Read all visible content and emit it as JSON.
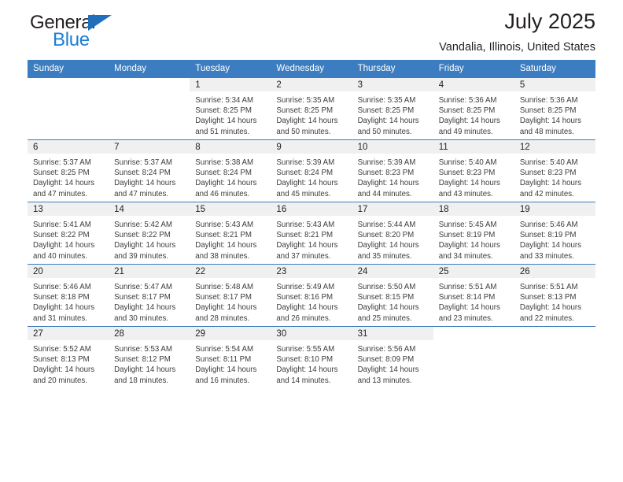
{
  "brand": {
    "name_top": "General",
    "name_bottom": "Blue",
    "triangle_icon": "triangle-icon",
    "color_dark": "#231f20",
    "color_blue": "#1b7fd4"
  },
  "header": {
    "title": "July 2025",
    "subtitle": "Vandalia, Illinois, United States",
    "accent_color": "#3b7dc0"
  },
  "calendar": {
    "weekday_headers": [
      "Sunday",
      "Monday",
      "Tuesday",
      "Wednesday",
      "Thursday",
      "Friday",
      "Saturday"
    ],
    "weeks": [
      [
        {
          "day": "",
          "blank": true,
          "sunrise": "",
          "sunset": "",
          "daylight_line1": "",
          "daylight_line2": ""
        },
        {
          "day": "",
          "blank": true,
          "sunrise": "",
          "sunset": "",
          "daylight_line1": "",
          "daylight_line2": ""
        },
        {
          "day": "1",
          "sunrise": "Sunrise: 5:34 AM",
          "sunset": "Sunset: 8:25 PM",
          "daylight_line1": "Daylight: 14 hours",
          "daylight_line2": "and 51 minutes."
        },
        {
          "day": "2",
          "sunrise": "Sunrise: 5:35 AM",
          "sunset": "Sunset: 8:25 PM",
          "daylight_line1": "Daylight: 14 hours",
          "daylight_line2": "and 50 minutes."
        },
        {
          "day": "3",
          "sunrise": "Sunrise: 5:35 AM",
          "sunset": "Sunset: 8:25 PM",
          "daylight_line1": "Daylight: 14 hours",
          "daylight_line2": "and 50 minutes."
        },
        {
          "day": "4",
          "sunrise": "Sunrise: 5:36 AM",
          "sunset": "Sunset: 8:25 PM",
          "daylight_line1": "Daylight: 14 hours",
          "daylight_line2": "and 49 minutes."
        },
        {
          "day": "5",
          "sunrise": "Sunrise: 5:36 AM",
          "sunset": "Sunset: 8:25 PM",
          "daylight_line1": "Daylight: 14 hours",
          "daylight_line2": "and 48 minutes."
        }
      ],
      [
        {
          "day": "6",
          "sunrise": "Sunrise: 5:37 AM",
          "sunset": "Sunset: 8:25 PM",
          "daylight_line1": "Daylight: 14 hours",
          "daylight_line2": "and 47 minutes."
        },
        {
          "day": "7",
          "sunrise": "Sunrise: 5:37 AM",
          "sunset": "Sunset: 8:24 PM",
          "daylight_line1": "Daylight: 14 hours",
          "daylight_line2": "and 47 minutes."
        },
        {
          "day": "8",
          "sunrise": "Sunrise: 5:38 AM",
          "sunset": "Sunset: 8:24 PM",
          "daylight_line1": "Daylight: 14 hours",
          "daylight_line2": "and 46 minutes."
        },
        {
          "day": "9",
          "sunrise": "Sunrise: 5:39 AM",
          "sunset": "Sunset: 8:24 PM",
          "daylight_line1": "Daylight: 14 hours",
          "daylight_line2": "and 45 minutes."
        },
        {
          "day": "10",
          "sunrise": "Sunrise: 5:39 AM",
          "sunset": "Sunset: 8:23 PM",
          "daylight_line1": "Daylight: 14 hours",
          "daylight_line2": "and 44 minutes."
        },
        {
          "day": "11",
          "sunrise": "Sunrise: 5:40 AM",
          "sunset": "Sunset: 8:23 PM",
          "daylight_line1": "Daylight: 14 hours",
          "daylight_line2": "and 43 minutes."
        },
        {
          "day": "12",
          "sunrise": "Sunrise: 5:40 AM",
          "sunset": "Sunset: 8:23 PM",
          "daylight_line1": "Daylight: 14 hours",
          "daylight_line2": "and 42 minutes."
        }
      ],
      [
        {
          "day": "13",
          "sunrise": "Sunrise: 5:41 AM",
          "sunset": "Sunset: 8:22 PM",
          "daylight_line1": "Daylight: 14 hours",
          "daylight_line2": "and 40 minutes."
        },
        {
          "day": "14",
          "sunrise": "Sunrise: 5:42 AM",
          "sunset": "Sunset: 8:22 PM",
          "daylight_line1": "Daylight: 14 hours",
          "daylight_line2": "and 39 minutes."
        },
        {
          "day": "15",
          "sunrise": "Sunrise: 5:43 AM",
          "sunset": "Sunset: 8:21 PM",
          "daylight_line1": "Daylight: 14 hours",
          "daylight_line2": "and 38 minutes."
        },
        {
          "day": "16",
          "sunrise": "Sunrise: 5:43 AM",
          "sunset": "Sunset: 8:21 PM",
          "daylight_line1": "Daylight: 14 hours",
          "daylight_line2": "and 37 minutes."
        },
        {
          "day": "17",
          "sunrise": "Sunrise: 5:44 AM",
          "sunset": "Sunset: 8:20 PM",
          "daylight_line1": "Daylight: 14 hours",
          "daylight_line2": "and 35 minutes."
        },
        {
          "day": "18",
          "sunrise": "Sunrise: 5:45 AM",
          "sunset": "Sunset: 8:19 PM",
          "daylight_line1": "Daylight: 14 hours",
          "daylight_line2": "and 34 minutes."
        },
        {
          "day": "19",
          "sunrise": "Sunrise: 5:46 AM",
          "sunset": "Sunset: 8:19 PM",
          "daylight_line1": "Daylight: 14 hours",
          "daylight_line2": "and 33 minutes."
        }
      ],
      [
        {
          "day": "20",
          "sunrise": "Sunrise: 5:46 AM",
          "sunset": "Sunset: 8:18 PM",
          "daylight_line1": "Daylight: 14 hours",
          "daylight_line2": "and 31 minutes."
        },
        {
          "day": "21",
          "sunrise": "Sunrise: 5:47 AM",
          "sunset": "Sunset: 8:17 PM",
          "daylight_line1": "Daylight: 14 hours",
          "daylight_line2": "and 30 minutes."
        },
        {
          "day": "22",
          "sunrise": "Sunrise: 5:48 AM",
          "sunset": "Sunset: 8:17 PM",
          "daylight_line1": "Daylight: 14 hours",
          "daylight_line2": "and 28 minutes."
        },
        {
          "day": "23",
          "sunrise": "Sunrise: 5:49 AM",
          "sunset": "Sunset: 8:16 PM",
          "daylight_line1": "Daylight: 14 hours",
          "daylight_line2": "and 26 minutes."
        },
        {
          "day": "24",
          "sunrise": "Sunrise: 5:50 AM",
          "sunset": "Sunset: 8:15 PM",
          "daylight_line1": "Daylight: 14 hours",
          "daylight_line2": "and 25 minutes."
        },
        {
          "day": "25",
          "sunrise": "Sunrise: 5:51 AM",
          "sunset": "Sunset: 8:14 PM",
          "daylight_line1": "Daylight: 14 hours",
          "daylight_line2": "and 23 minutes."
        },
        {
          "day": "26",
          "sunrise": "Sunrise: 5:51 AM",
          "sunset": "Sunset: 8:13 PM",
          "daylight_line1": "Daylight: 14 hours",
          "daylight_line2": "and 22 minutes."
        }
      ],
      [
        {
          "day": "27",
          "sunrise": "Sunrise: 5:52 AM",
          "sunset": "Sunset: 8:13 PM",
          "daylight_line1": "Daylight: 14 hours",
          "daylight_line2": "and 20 minutes."
        },
        {
          "day": "28",
          "sunrise": "Sunrise: 5:53 AM",
          "sunset": "Sunset: 8:12 PM",
          "daylight_line1": "Daylight: 14 hours",
          "daylight_line2": "and 18 minutes."
        },
        {
          "day": "29",
          "sunrise": "Sunrise: 5:54 AM",
          "sunset": "Sunset: 8:11 PM",
          "daylight_line1": "Daylight: 14 hours",
          "daylight_line2": "and 16 minutes."
        },
        {
          "day": "30",
          "sunrise": "Sunrise: 5:55 AM",
          "sunset": "Sunset: 8:10 PM",
          "daylight_line1": "Daylight: 14 hours",
          "daylight_line2": "and 14 minutes."
        },
        {
          "day": "31",
          "sunrise": "Sunrise: 5:56 AM",
          "sunset": "Sunset: 8:09 PM",
          "daylight_line1": "Daylight: 14 hours",
          "daylight_line2": "and 13 minutes."
        },
        {
          "day": "",
          "blank": true,
          "sunrise": "",
          "sunset": "",
          "daylight_line1": "",
          "daylight_line2": ""
        },
        {
          "day": "",
          "blank": true,
          "sunrise": "",
          "sunset": "",
          "daylight_line1": "",
          "daylight_line2": ""
        }
      ]
    ]
  }
}
